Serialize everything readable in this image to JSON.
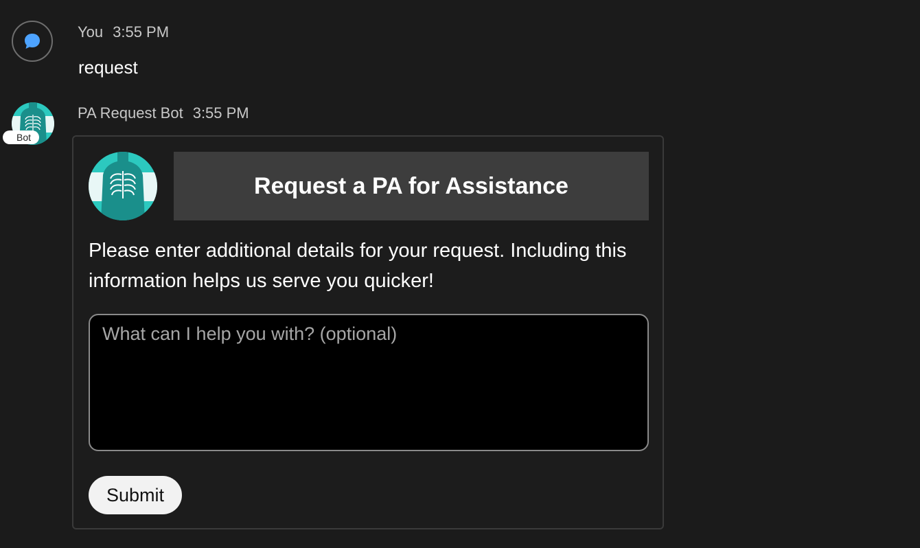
{
  "user_message": {
    "sender": "You",
    "time": "3:55 PM",
    "text": "request",
    "avatar_icon": "chat-bubble-icon",
    "accent_color": "#4da3ff"
  },
  "bot_message": {
    "sender": "PA Request Bot",
    "time": "3:55 PM",
    "badge": "Bot",
    "avatar_icon": "xray-torso-icon",
    "brand_color": "#2cc9bf"
  },
  "card": {
    "title": "Request a PA for Assistance",
    "description": "Please enter additional details for your request. Including this information helps us serve you quicker!",
    "input": {
      "value": "",
      "placeholder": "What can I help you with? (optional)"
    },
    "submit_label": "Submit"
  }
}
